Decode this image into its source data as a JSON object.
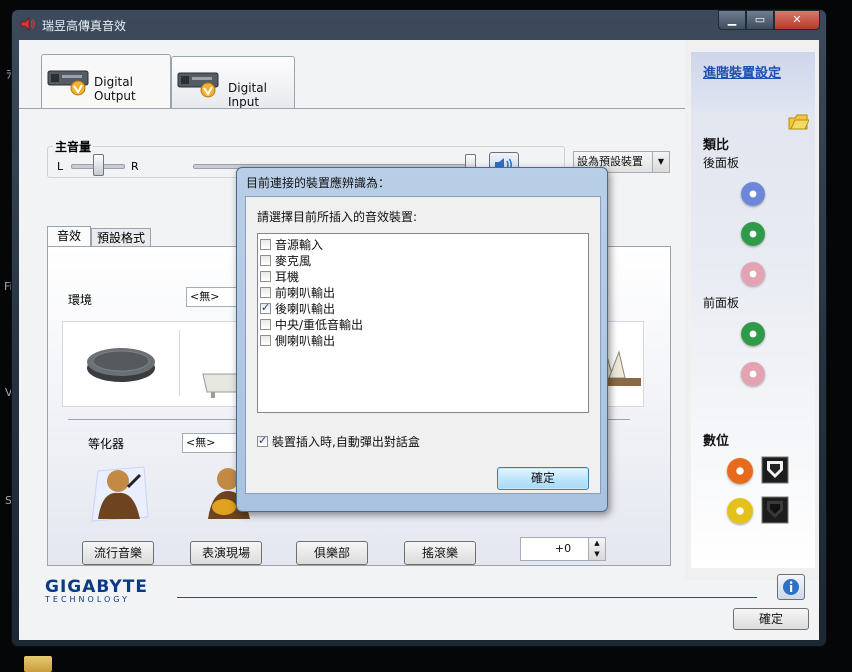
{
  "window": {
    "title": "瑞昱高傳真音效",
    "controls": {
      "minimize": "▁",
      "maximize": "▭",
      "close": "✕"
    }
  },
  "desktop": {
    "fragments": [
      "ﾗ",
      "Fi",
      "V",
      "S"
    ]
  },
  "device_tabs": [
    {
      "label": "Digital Output",
      "active": true
    },
    {
      "label": "Digital Input",
      "active": false
    }
  ],
  "master_volume": {
    "title": "主音量",
    "left_label": "L",
    "right_label": "R",
    "balance": 0.5,
    "level": 1.0,
    "set_default_label": "設為預設裝置"
  },
  "effect_tabs": [
    {
      "label": "音效",
      "active": true
    },
    {
      "label": "預設格式",
      "active": false
    }
  ],
  "environment": {
    "label": "環境",
    "value": "<無>"
  },
  "equalizer": {
    "label": "等化器",
    "value": "<無>",
    "presets": [
      "流行音樂",
      "表演現場",
      "俱樂部",
      "搖滾樂"
    ],
    "karaoke_value": "+0"
  },
  "side_panel": {
    "advanced_link": "進階裝置設定",
    "analog_title": "類比",
    "rear_panel": "後面板",
    "front_panel": "前面板",
    "digital_title": "數位",
    "colors": {
      "blue": "#6d87d8",
      "green": "#2f9a4a",
      "pink": "#e4a3b2",
      "orange": "#e86a1c",
      "yellow": "#e5c21a"
    }
  },
  "footer": {
    "brand": "GIGABYTE",
    "brand_sub": "TECHNOLOGY",
    "ok_label": "確定"
  },
  "dialog": {
    "title": "目前連接的裝置應辨識為：",
    "prompt": "請選擇目前所插入的音效裝置:",
    "options": [
      {
        "label": "音源輸入",
        "checked": false
      },
      {
        "label": "麥克風",
        "checked": false
      },
      {
        "label": "耳機",
        "checked": false
      },
      {
        "label": "前喇叭輸出",
        "checked": false
      },
      {
        "label": "後喇叭輸出",
        "checked": true
      },
      {
        "label": "中央/重低音輸出",
        "checked": false
      },
      {
        "label": "側喇叭輸出",
        "checked": false
      }
    ],
    "auto_popup_label": "裝置插入時,自動彈出對話盒",
    "auto_popup_checked": true,
    "ok_label": "確定"
  }
}
